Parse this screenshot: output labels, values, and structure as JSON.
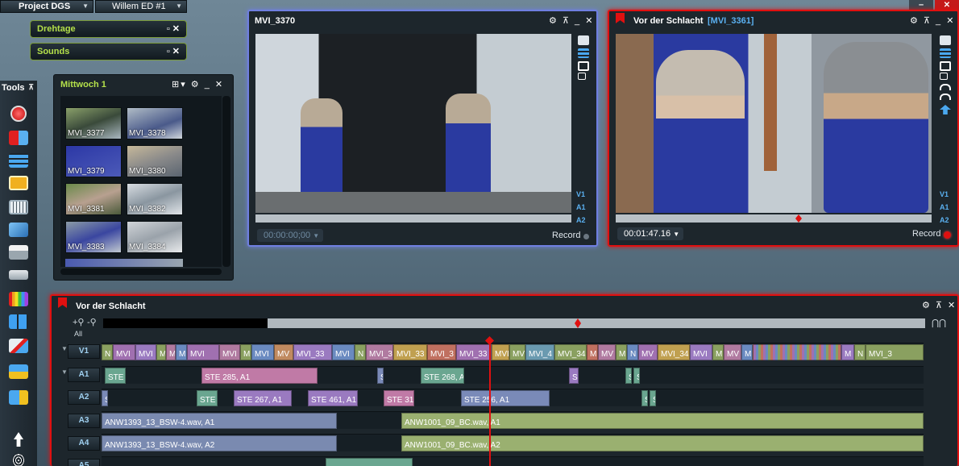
{
  "top": {
    "project": "Project DGS",
    "user": "Willem ED #1"
  },
  "pills": {
    "drehtage": "Drehtage",
    "sounds": "Sounds",
    "controls": "▫ ✕"
  },
  "window_controls": {
    "minimize": "–",
    "close": "✕"
  },
  "tools": {
    "title": "Tools",
    "pin": "⊼"
  },
  "bin": {
    "title": "Mittwoch 1",
    "items": [
      "MVI_3377",
      "MVI_3378",
      "MVI_3379",
      "MVI_3380",
      "MVI_3381",
      "MVI_3382",
      "MVI_3383",
      "MVI_3384"
    ]
  },
  "source": {
    "title": "MVI_3370",
    "timecode": "00:00:00;00",
    "record": "Record",
    "tracks": [
      "V1",
      "A1",
      "A2"
    ]
  },
  "program": {
    "title": "Vor der Schlacht",
    "clip": "[MVI_3361]",
    "timecode": "00:01:47.16",
    "record": "Record",
    "tracks": [
      "V1",
      "A1",
      "A2"
    ]
  },
  "timeline": {
    "title": "Vor der Schlacht",
    "zoom_in": "+⚲",
    "zoom_out": "-⚲",
    "all": "All",
    "tracks": [
      "V1",
      "A1",
      "A2",
      "A3",
      "A4",
      "A5"
    ],
    "v1_clips": [
      "N",
      "MVI",
      "MVI",
      "M",
      "M",
      "M",
      "MVI",
      "MVI",
      "M",
      "MVI",
      "MV",
      "MVI_33",
      "MVI",
      "N",
      "MVI_3",
      "MVI_33",
      "MVI_3",
      "MVI_33",
      "MVI",
      "MV",
      "MVI_4",
      "MVI_34",
      "M",
      "MV",
      "M",
      "N",
      "MV",
      "MVI_34",
      "MVI",
      "M",
      "MV",
      "M",
      "M",
      "N",
      "MVI_3"
    ],
    "a1_clips": [
      "STE",
      "STE 285, A1",
      "S",
      "STE 268, A",
      "S",
      "S",
      "S"
    ],
    "a2_clips": [
      "S",
      "STE",
      "STE 267, A1",
      "STE 461, A1",
      "STE 31",
      "STE 256, A1",
      "S",
      "S"
    ],
    "a3_clips": [
      "ANW1393_13_BSW-4.wav, A1",
      "ANW1001_09_BC.wav, A1"
    ],
    "a4_clips": [
      "ANW1393_13_BSW-4.wav, A2",
      "ANW1001_09_BC.wav, A2"
    ]
  },
  "colors": {
    "accent_red": "#e01010",
    "accent_green": "#b4e04a",
    "accent_blue": "#6f7fe0"
  }
}
